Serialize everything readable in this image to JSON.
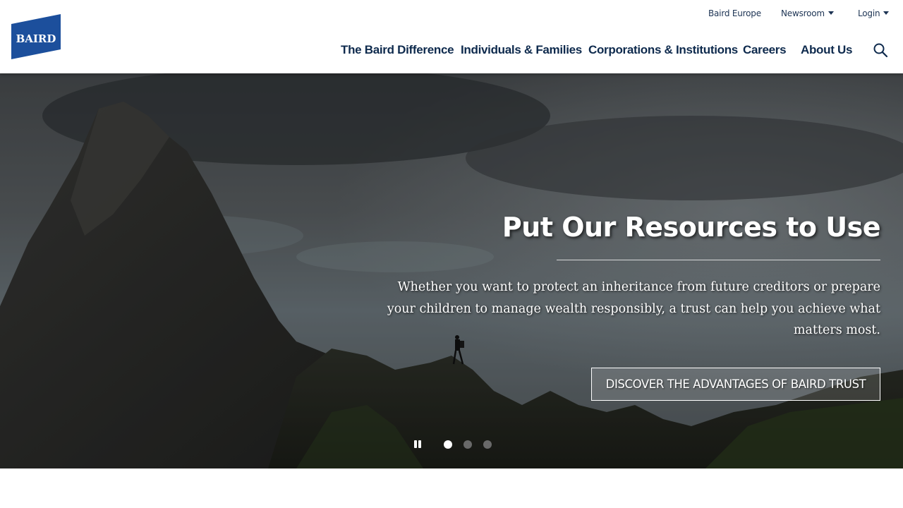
{
  "brand": {
    "logo_text": "BAIRD",
    "logo_color": "#1c4f9c"
  },
  "utility_nav": [
    {
      "label": "Baird Europe",
      "has_dropdown": false
    },
    {
      "label": "Newsroom",
      "has_dropdown": true
    },
    {
      "label": "Login",
      "has_dropdown": true
    }
  ],
  "main_nav": [
    {
      "label": "The Baird Difference"
    },
    {
      "label": "Individuals & Families"
    },
    {
      "label": "Corporations & Institutions"
    },
    {
      "label": "Careers"
    },
    {
      "label": "About Us"
    }
  ],
  "search": {
    "icon": "search-icon"
  },
  "hero": {
    "title": "Put Our Resources to Use",
    "body": "Whether you want to protect an inheritance from future creditors or prepare your children to manage wealth responsibly, a trust can help you achieve what matters most.",
    "cta_label": "DISCOVER THE ADVANTAGES OF BAIRD TRUST",
    "carousel": {
      "slide_count": 3,
      "active_slide": 1,
      "pause_icon": "pause-icon"
    }
  },
  "colors": {
    "nav_text": "#0e2a4d",
    "brand_blue": "#1c4f9c",
    "hero_text": "#ffffff"
  }
}
